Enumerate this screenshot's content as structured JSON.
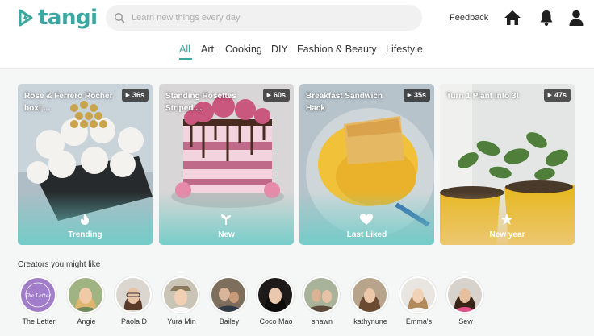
{
  "app": {
    "name": "tangi",
    "brand_color": "#3aa8a0"
  },
  "header": {
    "search_placeholder": "Learn new things every day",
    "feedback_label": "Feedback",
    "icons": [
      "home-icon",
      "bell-icon",
      "user-icon"
    ]
  },
  "categories": {
    "items": [
      "All",
      "Art",
      "Cooking",
      "DIY",
      "Fashion & Beauty",
      "Lifestyle"
    ],
    "active": "All"
  },
  "cards": [
    {
      "title": "Rose & Ferrero Rocher box! ...",
      "duration": "36s",
      "tag": "Trending",
      "tag_icon": "flame-icon"
    },
    {
      "title": "Standing Rosettes Striped ...",
      "duration": "60s",
      "tag": "New",
      "tag_icon": "sprout-icon"
    },
    {
      "title": "Breakfast Sandwich Hack",
      "duration": "35s",
      "tag": "Last Liked",
      "tag_icon": "heart-icon"
    },
    {
      "title": "Turn 1 Plant into 3!",
      "duration": "47s",
      "tag": "New year",
      "tag_icon": "star-icon"
    }
  ],
  "creators": {
    "title": "Creators you might like",
    "items": [
      {
        "name": "The Letter",
        "avatar_text": "The Letter Love"
      },
      {
        "name": "Angie"
      },
      {
        "name": "Paola D"
      },
      {
        "name": "Yura Min"
      },
      {
        "name": "Bailey"
      },
      {
        "name": "Coco Mao"
      },
      {
        "name": "shawn"
      },
      {
        "name": "kathynune"
      },
      {
        "name": "Emma's"
      },
      {
        "name": "Sew"
      }
    ]
  }
}
